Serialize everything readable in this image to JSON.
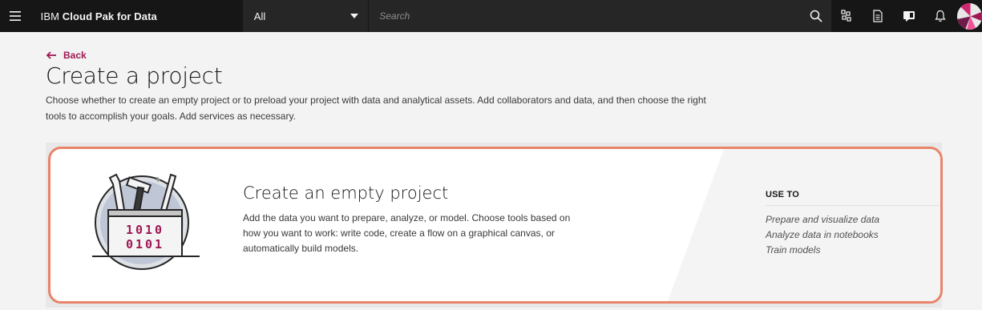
{
  "header": {
    "brand_prefix": "IBM",
    "brand_name": "Cloud Pak for Data",
    "scope_value": "All",
    "search_placeholder": "Search",
    "icons": [
      "menu-icon",
      "search-icon",
      "app-switcher-icon",
      "document-icon",
      "help-icon",
      "notification-icon",
      "user-avatar"
    ]
  },
  "page": {
    "back_label": "Back",
    "title": "Create a project",
    "description": "Choose whether to create an empty project or to preload your project with data and analytical assets. Add collaborators and data, and then choose the right tools to accomplish your goals. Add services as necessary."
  },
  "card": {
    "title": "Create an empty project",
    "description": "Add the data you want to prepare, analyze, or model. Choose tools based on how you want to work: write code, create a flow on a graphical canvas, or automatically build models.",
    "illustration_text_line1": "1010",
    "illustration_text_line2": "0101",
    "use_to_heading": "USE TO",
    "use_to_items": [
      "Prepare and visualize data",
      "Analyze data in notebooks",
      "Train models"
    ]
  },
  "colors": {
    "topbar_bg": "#161616",
    "accent_magenta": "#9f1853",
    "card_highlight_border": "#e9836a",
    "page_bg": "#f3f3f3"
  }
}
